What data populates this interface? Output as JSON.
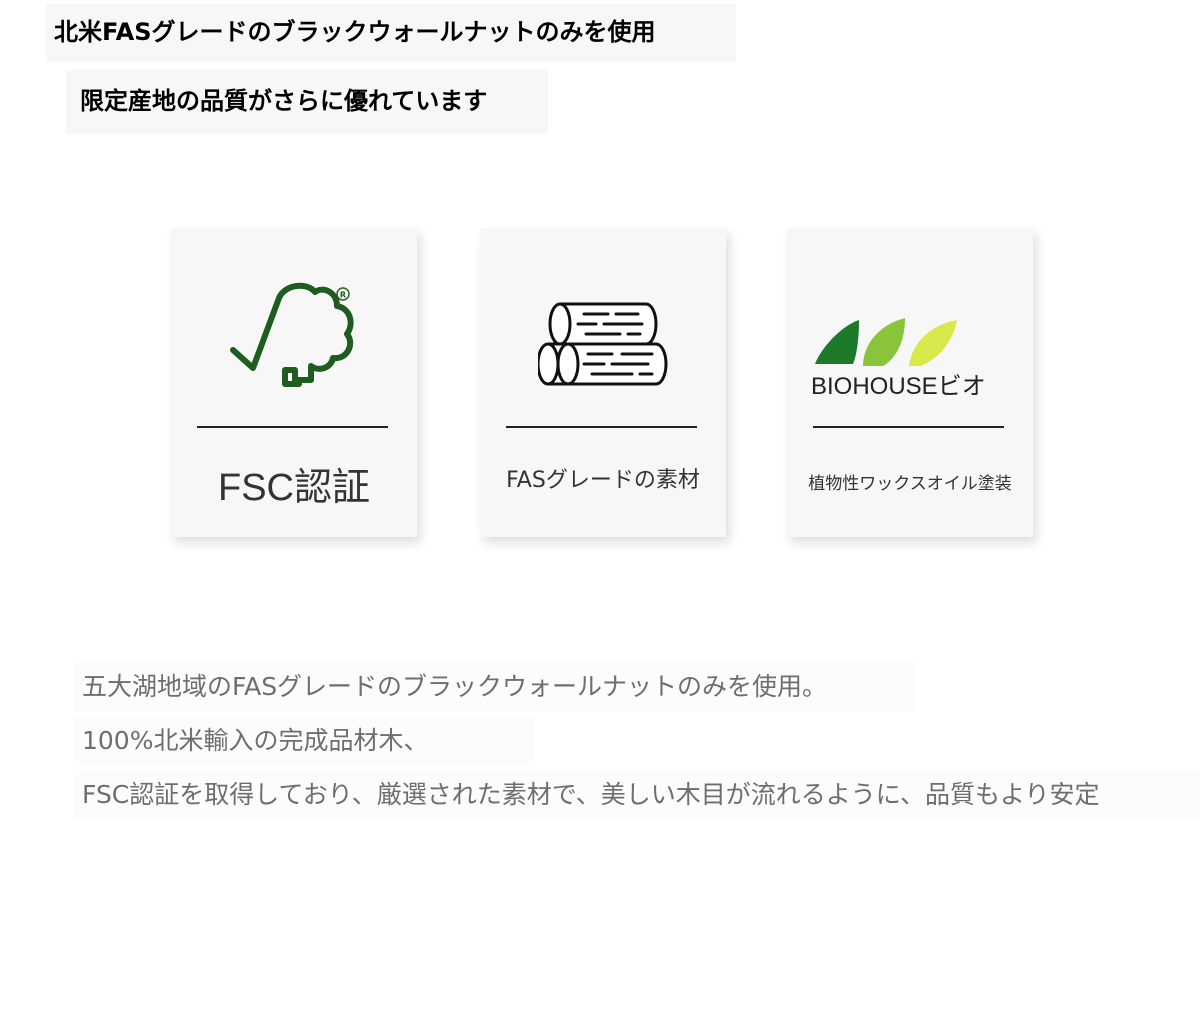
{
  "headings": {
    "title": "北米FASグレードのブラックウォールナットのみを使用",
    "subtitle": "限定産地の品質がさらに優れています"
  },
  "cards": {
    "fsc": {
      "icon": "fsc-tree-check-icon",
      "registered_mark": "®",
      "label": "FSC認証",
      "color": "#1f5c1f"
    },
    "fas": {
      "icon": "stacked-logs-icon",
      "label": "FASグレードの素材",
      "color": "#111111"
    },
    "bio": {
      "icon": "biohouse-leaves-logo",
      "brand": "BIOHOUSEビオ",
      "label": "植物性ワックスオイル塗装",
      "leaf_colors": [
        "#1d7a2a",
        "#8ac43a",
        "#d9e84a"
      ]
    }
  },
  "body": {
    "lines": [
      "五大湖地域のFASグレードのブラックウォールナットのみを使用。",
      "100%北米輸入の完成品材木、",
      "FSC認証を取得しており、厳選された素材で、美しい木目が流れるように、品質もより安定"
    ]
  }
}
